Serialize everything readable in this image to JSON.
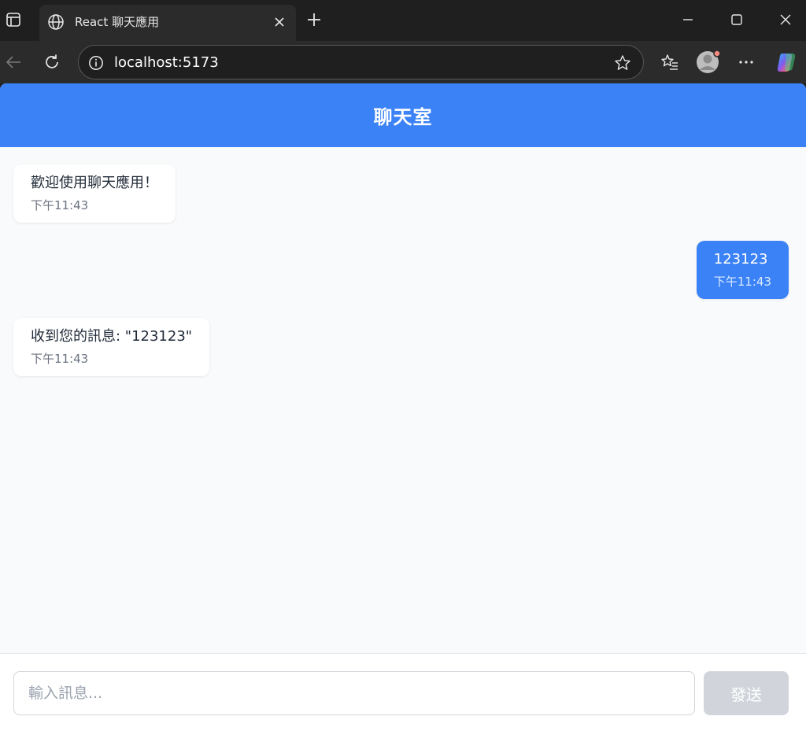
{
  "browser": {
    "tab_title": "React 聊天應用",
    "url": "localhost:5173"
  },
  "colors": {
    "header": "#3b82f6",
    "user_bubble": "#3b82f6",
    "page_bg": "#f9fafb",
    "send_disabled": "#d1d5db"
  },
  "chat": {
    "title": "聊天室",
    "messages": [
      {
        "sender": "bot",
        "text": "歡迎使用聊天應用！",
        "time": "下午11:43"
      },
      {
        "sender": "user",
        "text": "123123",
        "time": "下午11:43"
      },
      {
        "sender": "bot",
        "text": "收到您的訊息: \"123123\"",
        "time": "下午11:43"
      }
    ],
    "input_placeholder": "輸入訊息...",
    "send_label": "發送"
  }
}
